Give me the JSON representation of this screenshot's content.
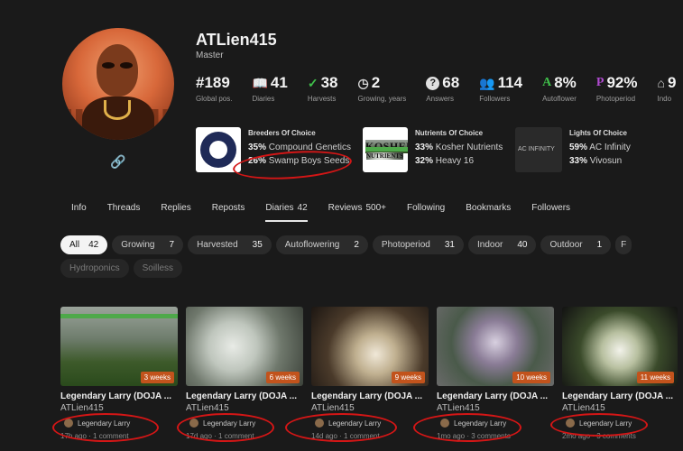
{
  "profile": {
    "username": "ATLien415",
    "rank": "Master",
    "stats": [
      {
        "icon": "",
        "value": "#189",
        "label": "Global pos."
      },
      {
        "icon": "📖",
        "value": "41",
        "label": "Diaries"
      },
      {
        "icon": "✓",
        "value": "38",
        "label": "Harvests"
      },
      {
        "icon": "◷",
        "value": "2",
        "label": "Growing, years"
      },
      {
        "icon": "?",
        "value": "68",
        "label": "Answers"
      },
      {
        "icon": "👥",
        "value": "114",
        "label": "Followers"
      },
      {
        "icon": "A",
        "value": "8%",
        "label": "Autoflower"
      },
      {
        "icon": "P",
        "value": "92%",
        "label": "Photoperiod"
      },
      {
        "icon": "⌂",
        "value": "9",
        "label": "Indo"
      }
    ]
  },
  "choices": {
    "breeders": {
      "title": "Breeders Of Choice",
      "items": [
        {
          "pct": "35%",
          "name": "Compound Genetics"
        },
        {
          "pct": "26%",
          "name": "Swamp Boys Seeds"
        }
      ]
    },
    "nutrients": {
      "title": "Nutrients Of Choice",
      "logo_text": "KOSHER",
      "logo_sub": "NUTRIENTS",
      "items": [
        {
          "pct": "33%",
          "name": "Kosher Nutrients"
        },
        {
          "pct": "32%",
          "name": "Heavy 16"
        }
      ]
    },
    "lights": {
      "title": "Lights Of Choice",
      "logo_text": "AC INFINITY",
      "items": [
        {
          "pct": "59%",
          "name": "AC Infinity"
        },
        {
          "pct": "33%",
          "name": "Vivosun"
        }
      ]
    }
  },
  "tabs": [
    {
      "label": "Info",
      "count": ""
    },
    {
      "label": "Threads",
      "count": ""
    },
    {
      "label": "Replies",
      "count": ""
    },
    {
      "label": "Reposts",
      "count": ""
    },
    {
      "label": "Diaries",
      "count": "42"
    },
    {
      "label": "Reviews",
      "count": "500+"
    },
    {
      "label": "Following",
      "count": ""
    },
    {
      "label": "Bookmarks",
      "count": ""
    },
    {
      "label": "Followers",
      "count": ""
    }
  ],
  "filters": [
    {
      "label": "All",
      "count": "42"
    },
    {
      "label": "Growing",
      "count": "7"
    },
    {
      "label": "Harvested",
      "count": "35"
    },
    {
      "label": "Autoflowering",
      "count": "2"
    },
    {
      "label": "Photoperiod",
      "count": "31"
    },
    {
      "label": "Indoor",
      "count": "40"
    },
    {
      "label": "Outdoor",
      "count": "1"
    },
    {
      "label": "F",
      "count": ""
    },
    {
      "label": "Hydroponics",
      "count": ""
    },
    {
      "label": "Soilless",
      "count": ""
    }
  ],
  "cards": [
    {
      "weeks": "3 weeks",
      "title": "Legendary Larry (DOJA ...",
      "user": "ATLien415",
      "strain": "Legendary Larry",
      "meta": "17h ago · 1 comment"
    },
    {
      "weeks": "6 weeks",
      "title": "Legendary Larry (DOJA ...",
      "user": "ATLien415",
      "strain": "Legendary Larry",
      "meta": "17d ago · 1 comment"
    },
    {
      "weeks": "9 weeks",
      "title": "Legendary Larry (DOJA ...",
      "user": "ATLien415",
      "strain": "Legendary Larry",
      "meta": "14d ago · 1 comment"
    },
    {
      "weeks": "10 weeks",
      "title": "Legendary Larry (DOJA ...",
      "user": "ATLien415",
      "strain": "Legendary Larry",
      "meta": "1mo ago · 3 comments"
    },
    {
      "weeks": "11 weeks",
      "title": "Legendary Larry (DOJA ...",
      "user": "ATLien415",
      "strain": "Legendary Larry",
      "meta": "2mo ago · 3 comments"
    }
  ],
  "colors": {
    "accent": "#c2531c",
    "annotation": "#d41616",
    "autoflower": "#3fbf4a",
    "photoperiod": "#b04ad0"
  }
}
